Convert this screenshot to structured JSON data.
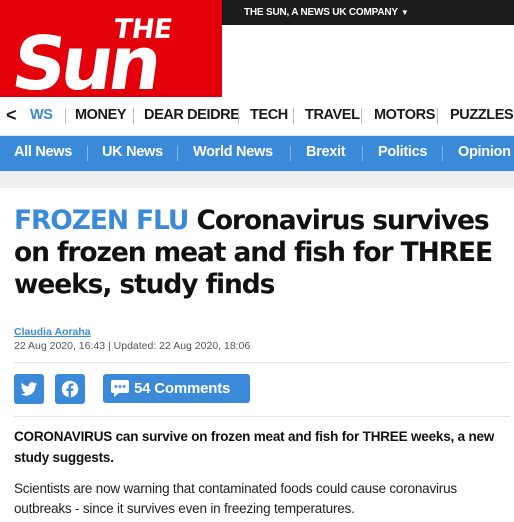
{
  "header": {
    "logo_small": "THE",
    "logo_big": "Sun",
    "company_link": "THE SUN, A NEWS UK COMPANY",
    "brand_red": "#e3000b",
    "topbar_color": "#1c1c1c"
  },
  "sections_nav": {
    "back_icon": "chevron-left-icon",
    "items": [
      "WS",
      "MONEY",
      "DEAR DEIDRE",
      "TECH",
      "TRAVEL",
      "MOTORS",
      "PUZZLES"
    ]
  },
  "blue_nav": {
    "color": "#3b8ad9",
    "items": [
      "All News",
      "UK News",
      "World News",
      "Brexit",
      "Politics",
      "Opinion"
    ]
  },
  "article": {
    "kicker": "FROZEN FLU",
    "headline": "Coronavirus survives on frozen meat and fish for THREE weeks, study finds",
    "author": "Claudia Aoraha",
    "dates": "22 Aug 2020, 16:43 | Updated: 22 Aug 2020, 18:06",
    "share": {
      "twitter_icon": "twitter-icon",
      "facebook_icon": "facebook-icon",
      "comments_icon": "comment-bubble-icon",
      "comments_label": "54 Comments"
    },
    "standfirst": "CORONAVIRUS can survive on frozen meat and fish for THREE weeks, a new study suggests.",
    "body_first": "Scientists are now warning that contaminated foods could cause coronavirus outbreaks - since it survives even in freezing temperatures."
  }
}
